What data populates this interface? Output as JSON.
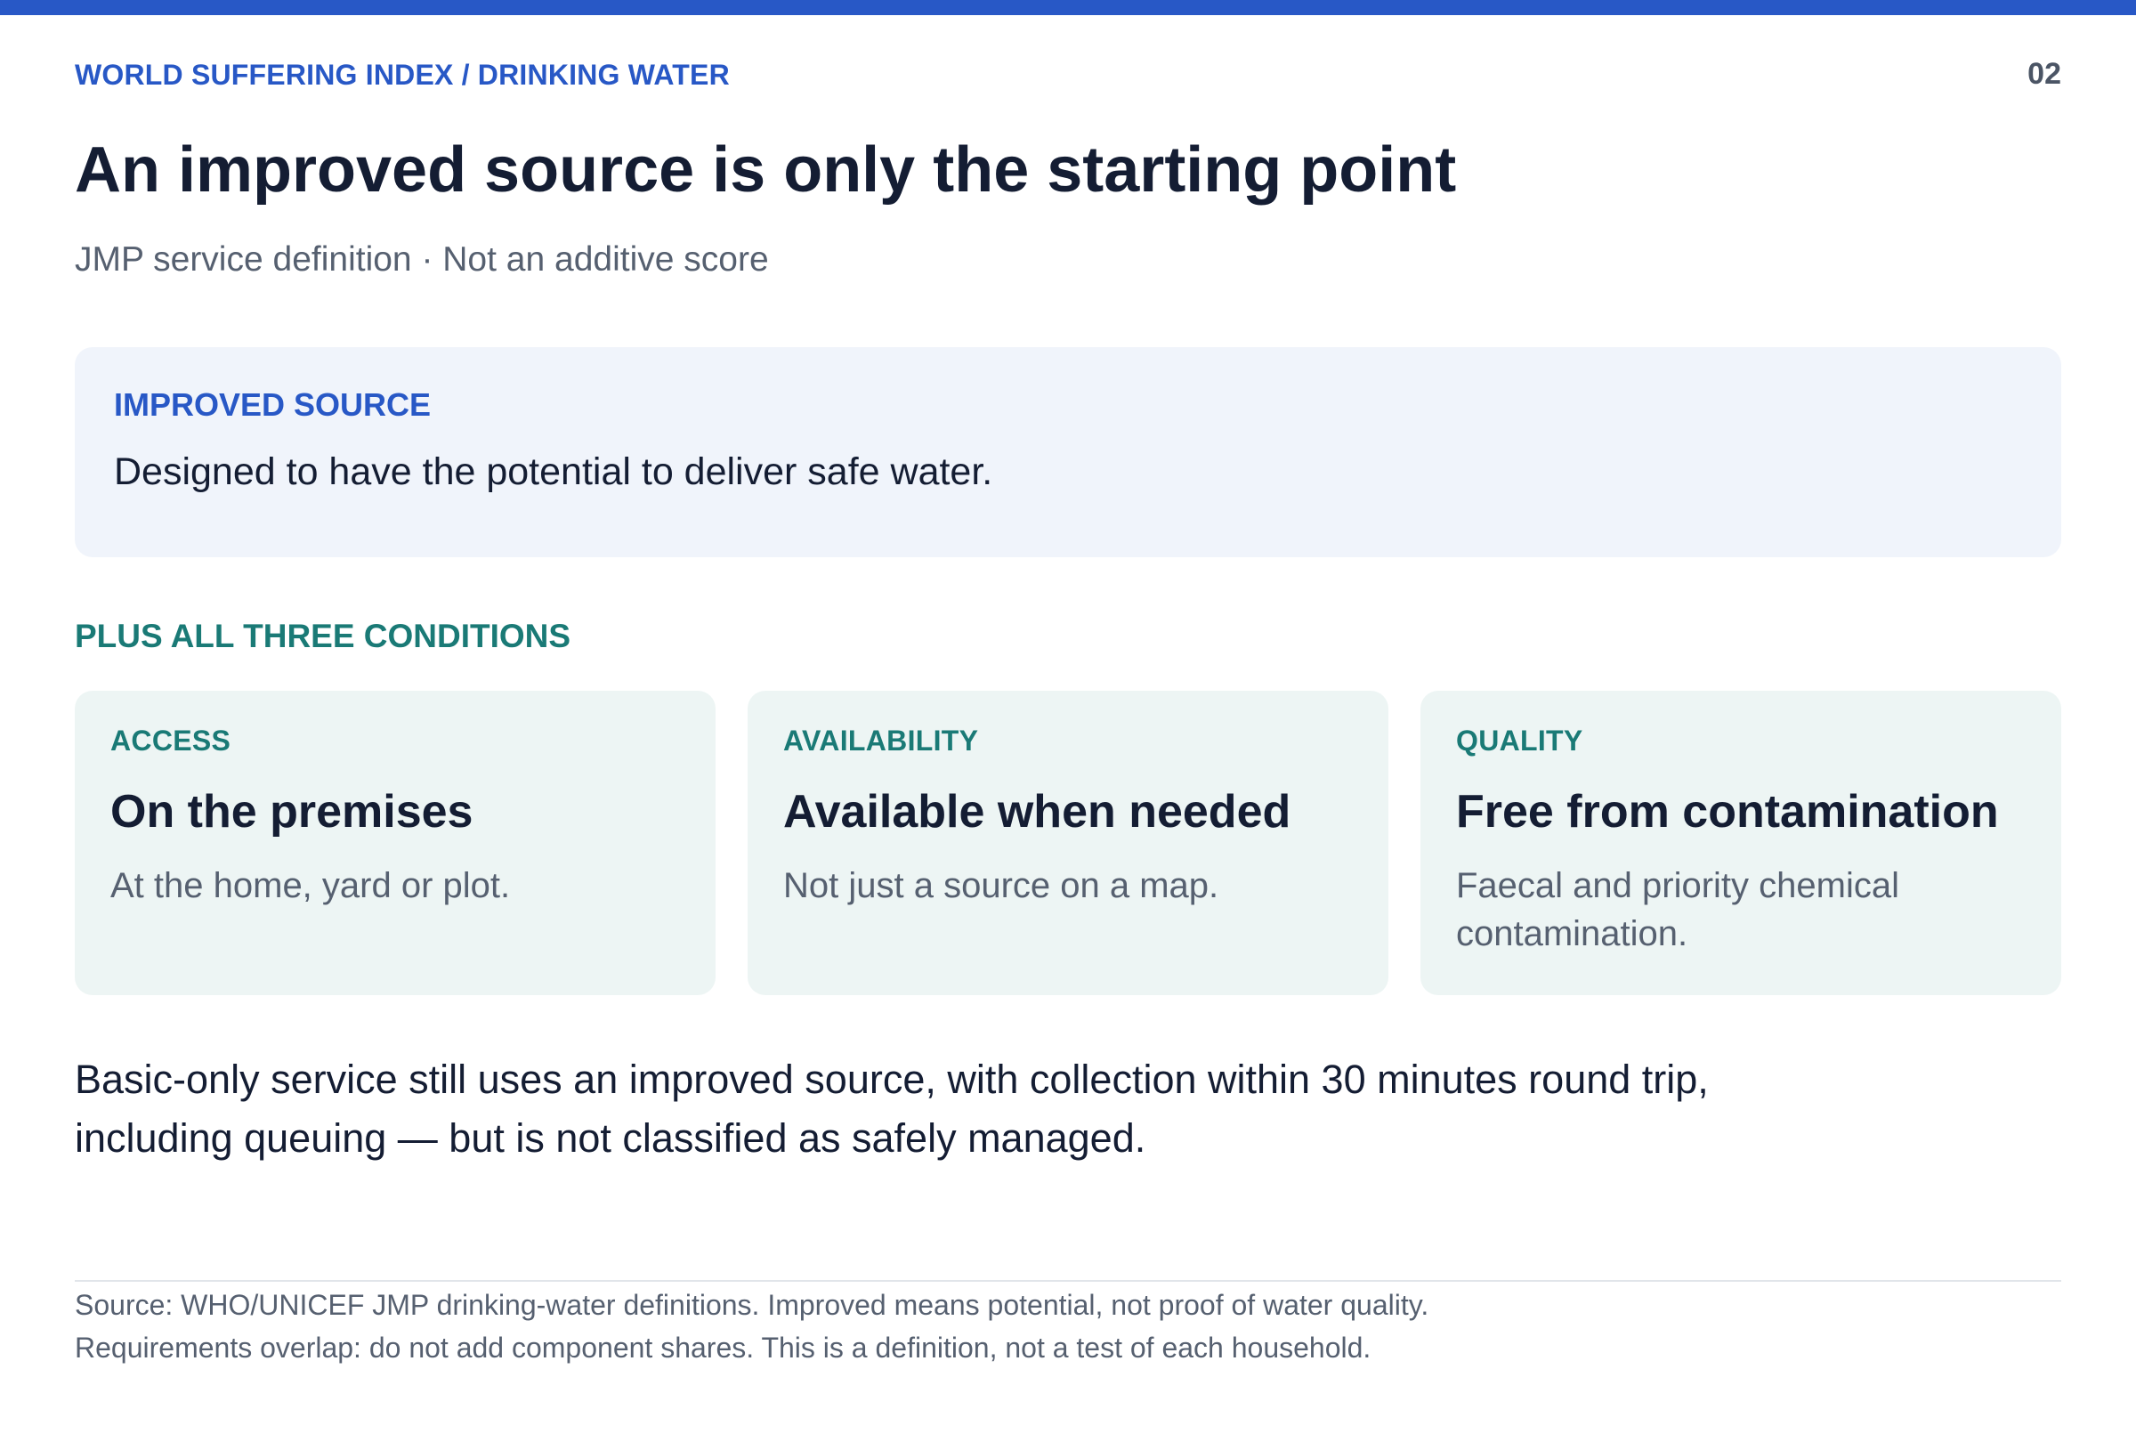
{
  "header": {
    "kicker": "WORLD SUFFERING INDEX / DRINKING WATER",
    "page_number": "02",
    "title": "An improved source is only the starting point",
    "subtitle": "JMP service definition · Not an additive score"
  },
  "improved_source": {
    "label": "IMPROVED SOURCE",
    "text": "Designed to have the potential to deliver safe water."
  },
  "conditions": {
    "heading": "PLUS ALL THREE CONDITIONS",
    "items": [
      {
        "label": "ACCESS",
        "title": "On the premises",
        "description": "At the home, yard or plot."
      },
      {
        "label": "AVAILABILITY",
        "title": "Available when needed",
        "description": "Not just a source on a map."
      },
      {
        "label": "QUALITY",
        "title": "Free from contamination",
        "description": "Faecal and priority chemical contamination."
      }
    ]
  },
  "note": "Basic-only service still uses an improved source, with collection within 30 minutes round trip, including queuing — but is not classified as safely managed.",
  "footer": {
    "line1": "Source: WHO/UNICEF JMP drinking-water definitions. Improved means potential, not proof of water quality.",
    "line2": "Requirements overlap: do not add component shares. This is a definition, not a test of each household."
  },
  "colors": {
    "accent_blue": "#2858c6",
    "accent_teal": "#1a7a76",
    "blue_panel": "#f0f4fb",
    "teal_panel": "#edf5f4"
  }
}
